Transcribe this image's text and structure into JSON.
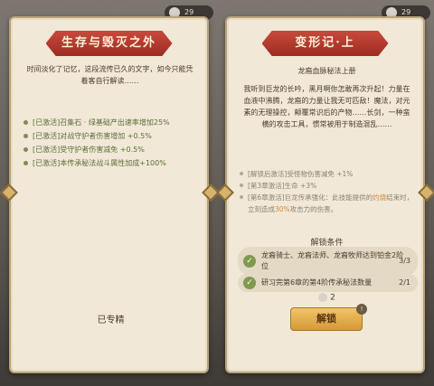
{
  "left_card": {
    "counter": "29",
    "title": "生存与毁灭之外",
    "intro": "时间淡化了记忆，这段流传已久的文字，如今只能凭着客自行解读……",
    "bonuses": [
      "[已激活]召集石 · 绿基础产出速率增加25%",
      "[已激活]对战守护者伤害增加 +0.5%",
      "[已激活]受守护者伤害减免 +0.5%",
      "[已激活]本传承秘法战斗属性加成+100%"
    ],
    "status": "已专精"
  },
  "right_card": {
    "counter": "29",
    "title": "变形记·上",
    "subtitle": "龙裔血脉秘法上册",
    "lore": "我听到巨龙的长吟，黑月啊你怎敢再次升起！力量在血液中沸腾，龙裔的力量让我无可匹敌！魔法，对元素的无理操控，颠覆常识后的产物……长剑，一种蛮横的攻击工具，惯常被用于制造混乱……",
    "locked_effects": [
      "[解锁后激活]受怪物伤害减免 +1%",
      "[第3章激活]生命 +3%",
      "[第6章激活]巨龙传承强化：此技能提供的",
      "灼烧",
      "结束时，立刻造成",
      "30%",
      "攻击力的伤害。"
    ],
    "conditions_title": "解锁条件",
    "conditions": [
      {
        "text": "龙裔骑士、龙裔法师、龙裔牧师达到铂金2阶位",
        "count": "3/3"
      },
      {
        "text": "研习完第6章的第4阶传承秘法数量",
        "count": "2/1"
      }
    ],
    "cost": "2",
    "unlock_label": "解锁",
    "info_badge": "!"
  }
}
